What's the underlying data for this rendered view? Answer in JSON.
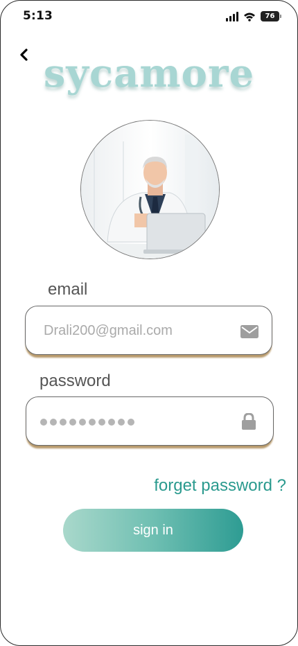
{
  "status_bar": {
    "time": "5:13",
    "battery": "76"
  },
  "app": {
    "logo": "sycamore"
  },
  "form": {
    "email_label": "email",
    "email_value": "Drali200@gmail.com",
    "password_label": "password",
    "password_dot_count": 10,
    "forgot_label": "forget password ?",
    "submit_label": "sign in"
  },
  "colors": {
    "accent": "#2a9a8e",
    "logo": "#a8d6d3",
    "button_start": "#a9d8cb",
    "button_end": "#2e9c93",
    "field_shadow": "#b89a6c"
  },
  "icons": [
    "back-icon",
    "signal-icon",
    "wifi-icon",
    "battery-icon",
    "mail-icon",
    "lock-icon"
  ]
}
